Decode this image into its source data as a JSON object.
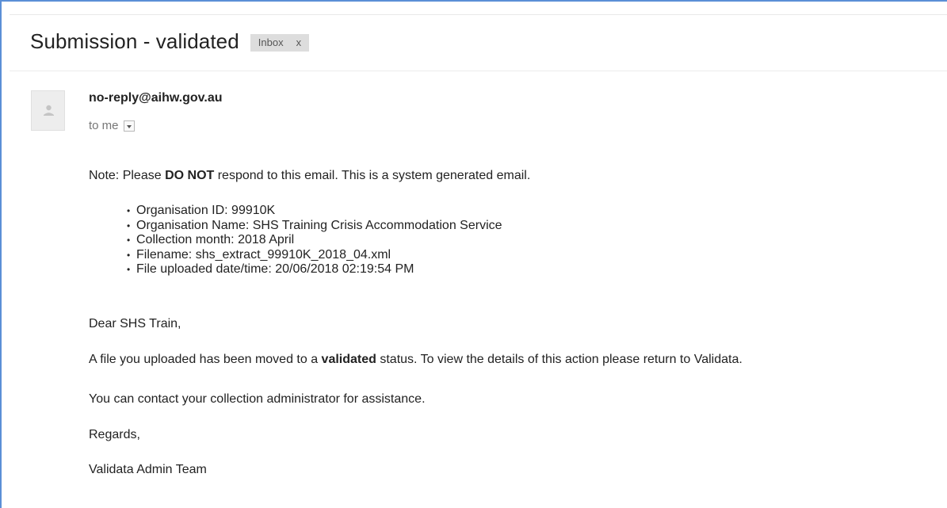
{
  "email": {
    "subject": "Submission - validated",
    "label": {
      "text": "Inbox",
      "remove": "x"
    },
    "sender": "no-reply@aihw.gov.au",
    "recipient": "to me",
    "note": {
      "before": "Note: Please ",
      "bold": "DO NOT",
      "after": " respond to this email. This is a system generated email."
    },
    "details": [
      "Organisation ID: 99910K",
      "Organisation Name: SHS Training Crisis Accommodation Service",
      "Collection month: 2018 April",
      "Filename: shs_extract_99910K_2018_04.xml",
      "File uploaded date/time: 20/06/2018 02:19:54 PM"
    ],
    "greeting": "Dear SHS Train,",
    "status": {
      "before": "A file you uploaded has been moved to a ",
      "bold": "validated",
      "after": " status. To view the details of this action please return to Validata."
    },
    "contact": "You can contact your collection administrator for assistance.",
    "regards": "Regards,",
    "signature": "Validata Admin Team"
  },
  "icons": {
    "avatar": "person-placeholder-icon",
    "recipient_menu": "chevron-down-icon"
  },
  "colors": {
    "frame_accent": "#5b8fd6",
    "label_bg": "#dddddd"
  }
}
